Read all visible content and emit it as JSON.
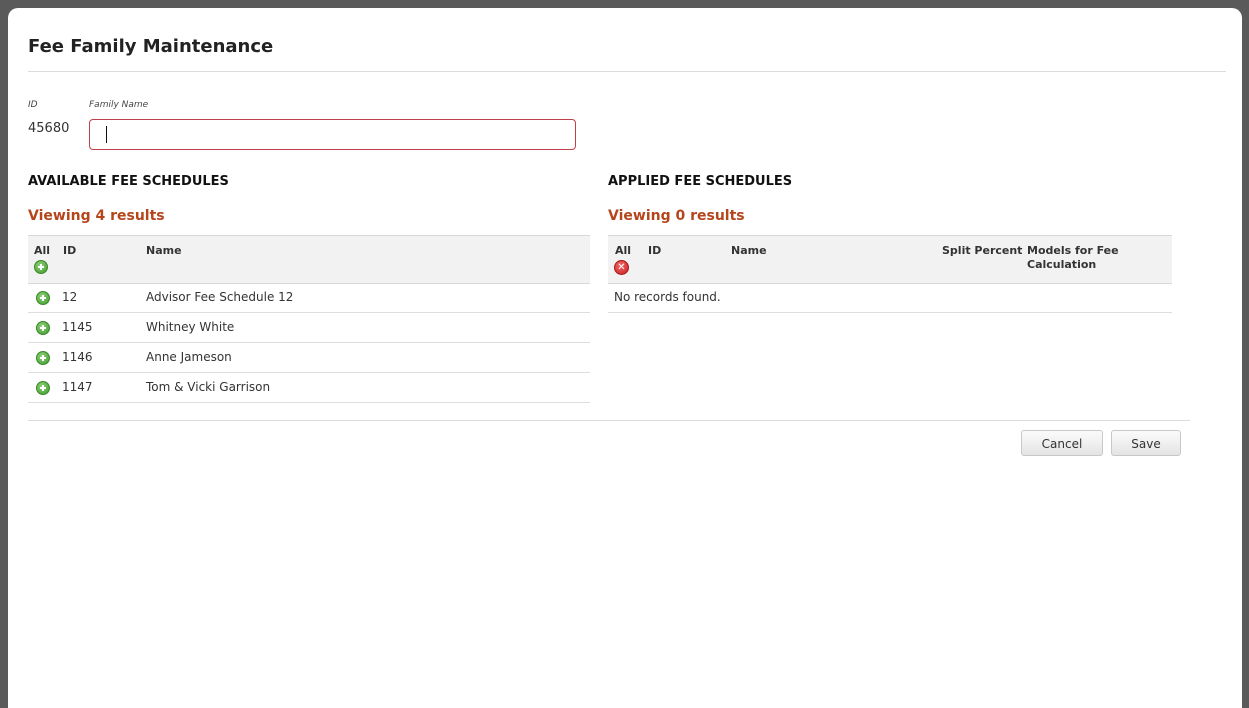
{
  "dialog": {
    "title": "Fee Family Maintenance"
  },
  "form": {
    "id_label": "ID",
    "id_value": "45680",
    "family_name_label": "Family Name",
    "family_name_value": "",
    "accent_color": "#c0404a"
  },
  "available": {
    "section_title": "AVAILABLE FEE SCHEDULES",
    "viewing_text": "Viewing 4 results",
    "columns": {
      "all": "All",
      "id": "ID",
      "name": "Name"
    },
    "add_icon": "add-circle-icon",
    "rows": [
      {
        "id": "12",
        "name": "Advisor Fee Schedule 12"
      },
      {
        "id": "1145",
        "name": "Whitney White"
      },
      {
        "id": "1146",
        "name": "Anne Jameson"
      },
      {
        "id": "1147",
        "name": "Tom & Vicki Garrison"
      }
    ]
  },
  "applied": {
    "section_title": "APPLIED FEE SCHEDULES",
    "viewing_text": "Viewing 0 results",
    "columns": {
      "all": "All",
      "id": "ID",
      "name": "Name",
      "split_percent": "Split Percent",
      "models": "Models for Fee Calculation"
    },
    "remove_icon": "remove-circle-icon",
    "empty_text": "No records found."
  },
  "actions": {
    "cancel_label": "Cancel",
    "save_label": "Save"
  },
  "colors": {
    "viewing_text": "#b5451b",
    "add_icon": "#3f9a2c",
    "remove_icon": "#c81e1e"
  }
}
